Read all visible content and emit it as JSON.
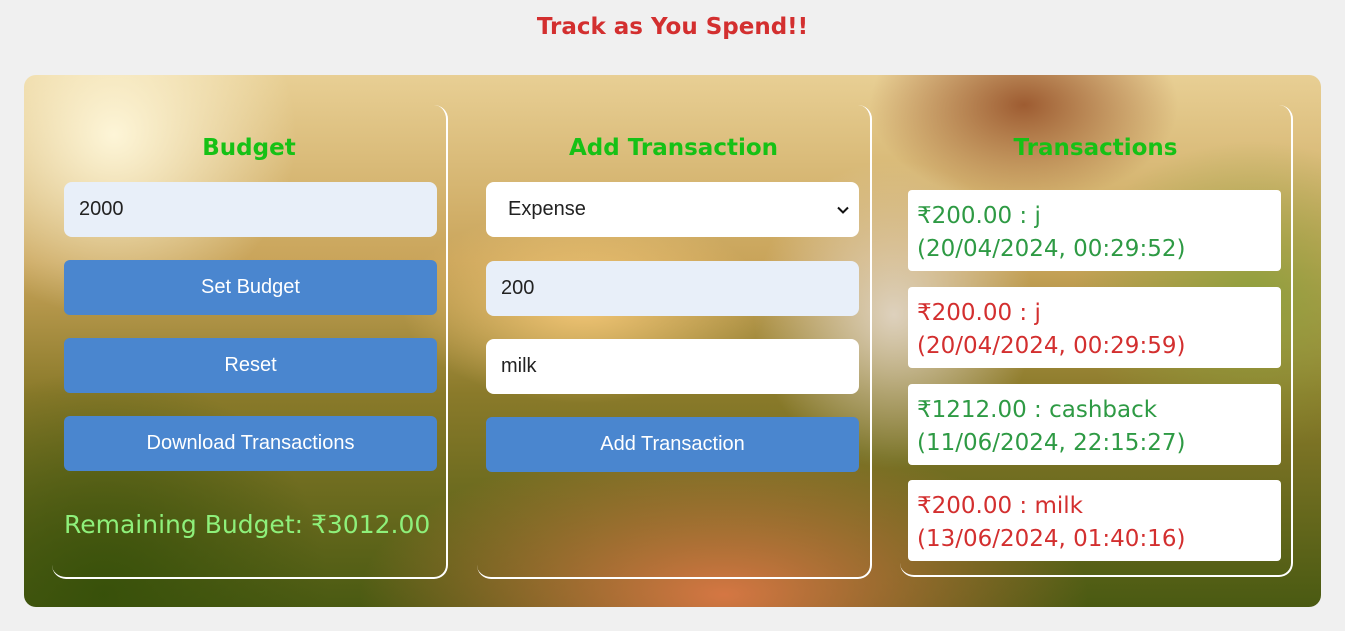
{
  "header": {
    "title": "Track as You Spend!!"
  },
  "budget_card": {
    "title": "Budget",
    "budget_input_value": "2000",
    "set_budget_label": "Set Budget",
    "reset_label": "Reset",
    "download_label": "Download Transactions",
    "remaining_label": "Remaining Budget: ₹3012.00"
  },
  "add_card": {
    "title": "Add Transaction",
    "type_select_value": "Expense",
    "amount_value": "200",
    "description_value": "milk",
    "add_button_label": "Add Transaction"
  },
  "transactions_card": {
    "title": "Transactions",
    "items": [
      {
        "line1": "₹200.00 : j",
        "line2": "(20/04/2024, 00:29:52)",
        "kind": "income"
      },
      {
        "line1": "₹200.00 : j",
        "line2": "(20/04/2024, 00:29:59)",
        "kind": "expense"
      },
      {
        "line1": "₹1212.00 : cashback",
        "line2": "(11/06/2024, 22:15:27)",
        "kind": "income"
      },
      {
        "line1": "₹200.00 : milk",
        "line2": "(13/06/2024, 01:40:16)",
        "kind": "expense"
      }
    ]
  },
  "colors": {
    "title_red": "#d32f2f",
    "heading_green": "#16c116",
    "button_blue": "#4a86cf",
    "income_green": "#2e9a44",
    "expense_red": "#d32f2f",
    "remaining_green": "#8ef07a"
  }
}
